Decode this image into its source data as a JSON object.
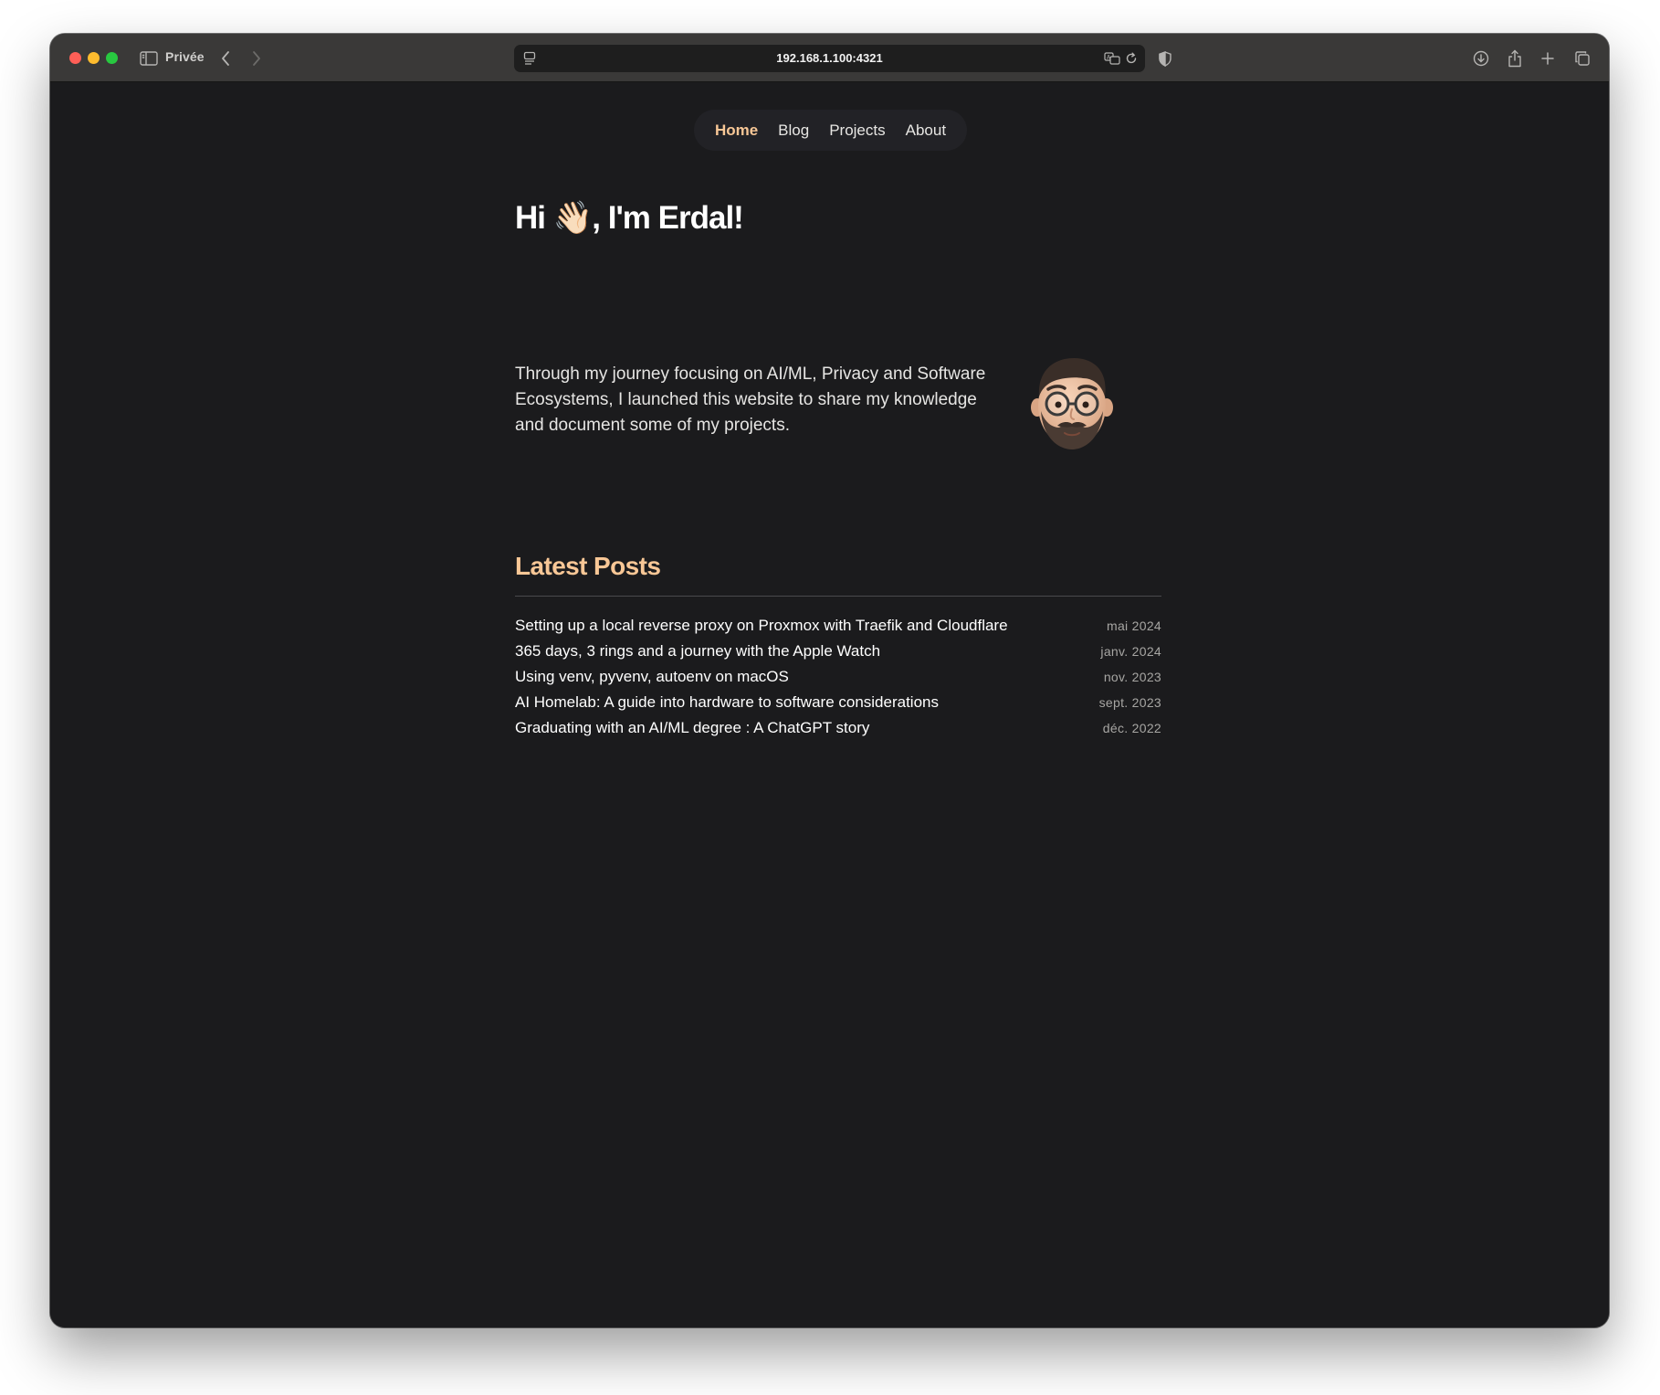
{
  "browser": {
    "private_label": "Privée",
    "address": "192.168.1.100:4321"
  },
  "nav": {
    "items": [
      {
        "label": "Home"
      },
      {
        "label": "Blog"
      },
      {
        "label": "Projects"
      },
      {
        "label": "About"
      }
    ],
    "active_index": 0
  },
  "hero": {
    "title": "Hi 👋🏻, I'm Erdal!",
    "intro": "Through my journey focusing on AI/ML, Privacy and Software Ecosystems, I launched this website to share my knowledge and document some of my projects."
  },
  "latest_posts": {
    "heading": "Latest Posts",
    "posts": [
      {
        "title": "Setting up a local reverse proxy on Proxmox with Traefik and Cloudflare",
        "date": "mai 2024"
      },
      {
        "title": "365 days, 3 rings and a journey with the Apple Watch",
        "date": "janv. 2024"
      },
      {
        "title": "Using venv, pyvenv, autoenv on macOS",
        "date": "nov. 2023"
      },
      {
        "title": "AI Homelab: A guide into hardware to software considerations",
        "date": "sept. 2023"
      },
      {
        "title": "Graduating with an AI/ML degree : A ChatGPT story",
        "date": "déc. 2022"
      }
    ]
  },
  "colors": {
    "accent": "#f8c796",
    "page_background": "#1b1b1d",
    "toolbar_background": "#3a3938",
    "nav_pill_background": "#222226"
  },
  "icons": [
    "sidebar-icon",
    "back-icon",
    "forward-icon",
    "page-menu-icon",
    "translate-icon",
    "reload-icon",
    "shield-icon",
    "downloads-icon",
    "share-icon",
    "new-tab-icon",
    "tab-overview-icon",
    "memoji-avatar"
  ]
}
